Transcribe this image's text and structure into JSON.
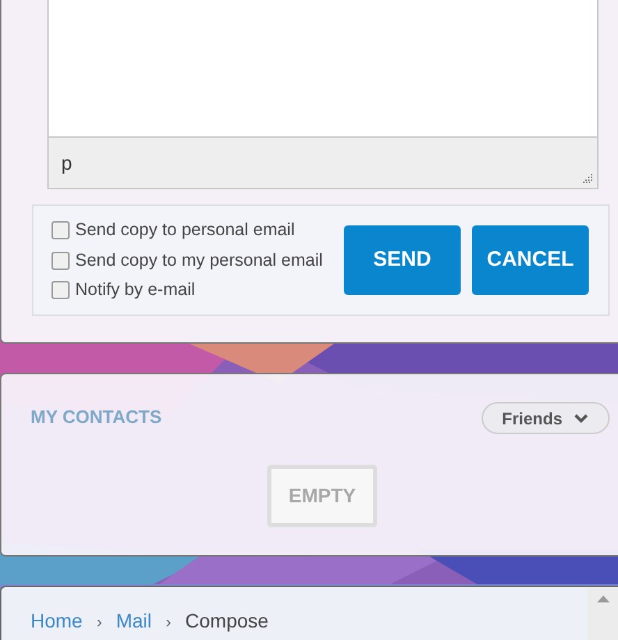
{
  "editor": {
    "status_path": "p"
  },
  "options": [
    {
      "label": "Send copy to personal email",
      "checked": false
    },
    {
      "label": "Send copy to my personal email",
      "checked": false
    },
    {
      "label": "Notify by e-mail",
      "checked": false
    }
  ],
  "buttons": [
    "SEND",
    "CANCEL"
  ],
  "contacts": {
    "title": "MY CONTACTS",
    "filter": "Friends",
    "empty": "EMPTY"
  },
  "breadcrumb": [
    {
      "kind": "link",
      "label": "Home"
    },
    {
      "kind": "separator",
      "label": "›"
    },
    {
      "kind": "link",
      "label": "Mail"
    },
    {
      "kind": "separator",
      "label": "›"
    },
    {
      "kind": "current",
      "label": "Compose"
    }
  ]
}
